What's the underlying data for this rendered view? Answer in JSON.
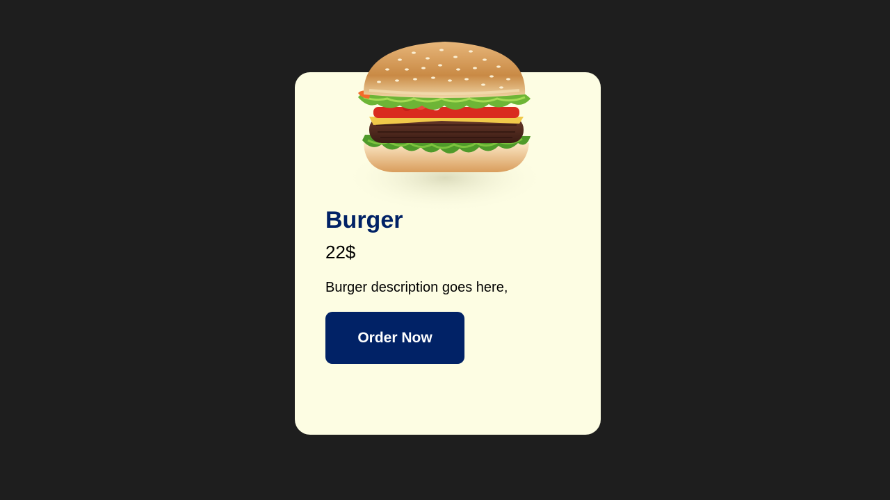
{
  "product": {
    "image": "burger-image",
    "title": "Burger",
    "price": "22$",
    "description": "Burger description goes here,",
    "order_button_label": "Order Now"
  },
  "colors": {
    "page_background": "#1e1e1e",
    "card_background": "#fdfde3",
    "accent": "#012266",
    "button_text": "#ffffff"
  }
}
